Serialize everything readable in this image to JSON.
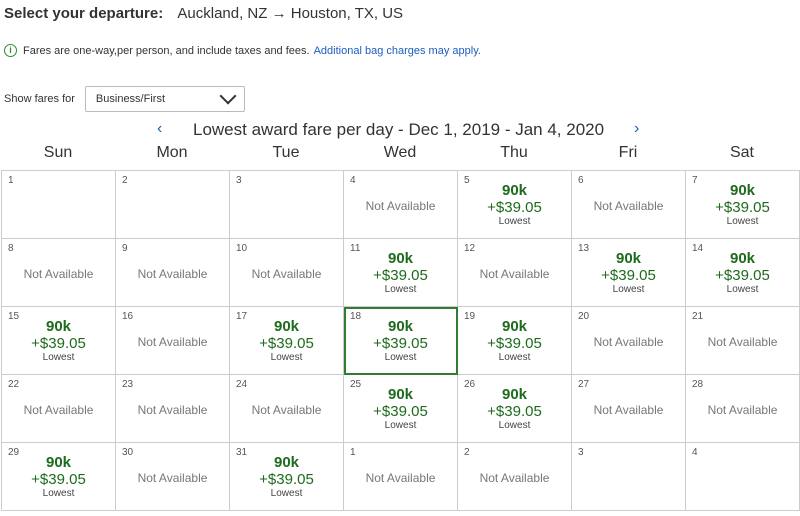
{
  "header": {
    "label": "Select your departure:",
    "route": "Auckland, NZ → Houston, TX, US"
  },
  "info": {
    "icon": "info-icon",
    "text_bold": "Fares are one-way,",
    "text": " per person, and include taxes and fees.",
    "link": "Additional bag charges may apply."
  },
  "filter": {
    "label": "Show fares for",
    "value": "Business/First"
  },
  "calendar": {
    "prev": "‹",
    "next": "›",
    "title": "Lowest award fare per day - Dec 1, 2019 - Jan 4, 2020",
    "days": [
      "Sun",
      "Mon",
      "Tue",
      "Wed",
      "Thu",
      "Fri",
      "Sat"
    ],
    "fare_miles": "90k",
    "fare_tax": "+$39.05",
    "fare_tag": "Lowest",
    "not_available": "Not Available",
    "weeks": [
      [
        {
          "d": "1",
          "s": "empty"
        },
        {
          "d": "2",
          "s": "empty"
        },
        {
          "d": "3",
          "s": "empty"
        },
        {
          "d": "4",
          "s": "na"
        },
        {
          "d": "5",
          "s": "fare"
        },
        {
          "d": "6",
          "s": "na"
        },
        {
          "d": "7",
          "s": "fare"
        }
      ],
      [
        {
          "d": "8",
          "s": "na"
        },
        {
          "d": "9",
          "s": "na"
        },
        {
          "d": "10",
          "s": "na"
        },
        {
          "d": "11",
          "s": "fare"
        },
        {
          "d": "12",
          "s": "na"
        },
        {
          "d": "13",
          "s": "fare"
        },
        {
          "d": "14",
          "s": "fare"
        }
      ],
      [
        {
          "d": "15",
          "s": "fare"
        },
        {
          "d": "16",
          "s": "na"
        },
        {
          "d": "17",
          "s": "fare"
        },
        {
          "d": "18",
          "s": "fare",
          "selected": true
        },
        {
          "d": "19",
          "s": "fare"
        },
        {
          "d": "20",
          "s": "na"
        },
        {
          "d": "21",
          "s": "na"
        }
      ],
      [
        {
          "d": "22",
          "s": "na"
        },
        {
          "d": "23",
          "s": "na"
        },
        {
          "d": "24",
          "s": "na"
        },
        {
          "d": "25",
          "s": "fare"
        },
        {
          "d": "26",
          "s": "fare"
        },
        {
          "d": "27",
          "s": "na"
        },
        {
          "d": "28",
          "s": "na"
        }
      ],
      [
        {
          "d": "29",
          "s": "fare"
        },
        {
          "d": "30",
          "s": "na"
        },
        {
          "d": "31",
          "s": "fare"
        },
        {
          "d": "1",
          "s": "na"
        },
        {
          "d": "2",
          "s": "na"
        },
        {
          "d": "3",
          "s": "empty"
        },
        {
          "d": "4",
          "s": "empty"
        }
      ]
    ]
  }
}
